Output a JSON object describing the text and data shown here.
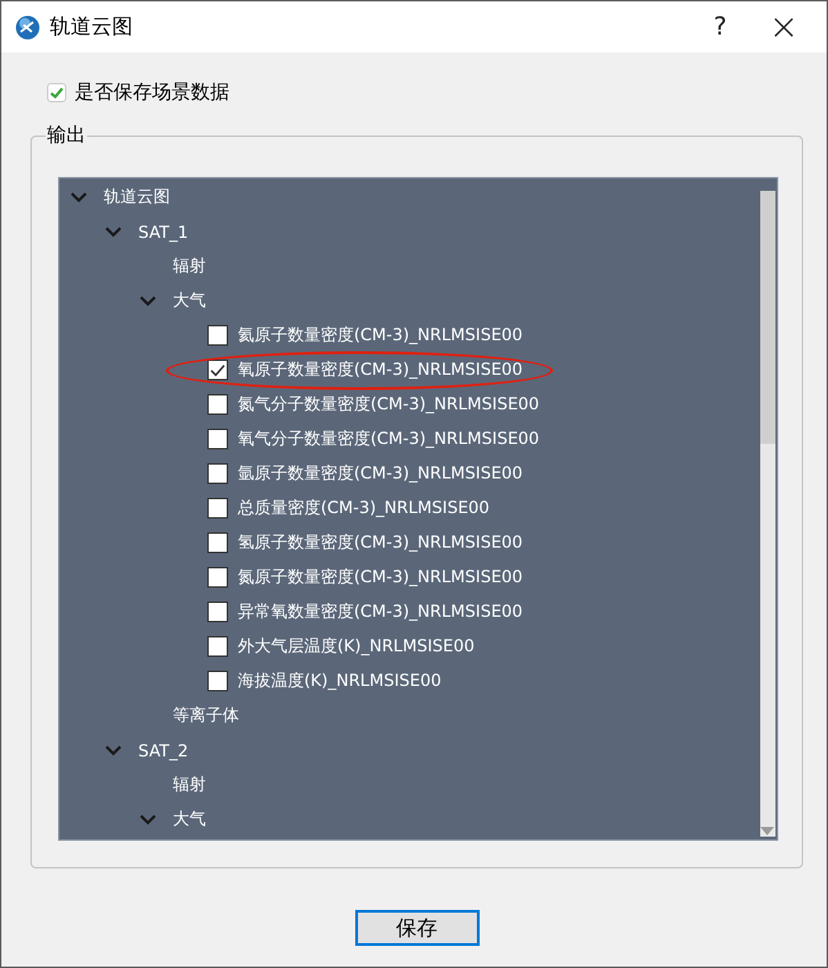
{
  "window": {
    "title": "轨道云图",
    "help": "?",
    "close": "×"
  },
  "save_scene": {
    "label": "是否保存场景数据",
    "checked": true
  },
  "output": {
    "title": "输出",
    "tree": [
      {
        "label": "轨道云图",
        "kind": "group",
        "expanded": true,
        "children": [
          {
            "label": "SAT_1",
            "kind": "group",
            "expanded": true,
            "children": [
              {
                "label": "辐射",
                "kind": "leaf"
              },
              {
                "label": "大气",
                "kind": "group",
                "expanded": true,
                "children": [
                  {
                    "label": "氦原子数量密度(CM-3)_NRLMSISE00",
                    "kind": "check",
                    "checked": false,
                    "highlighted": false
                  },
                  {
                    "label": "氧原子数量密度(CM-3)_NRLMSISE00",
                    "kind": "check",
                    "checked": true,
                    "highlighted": true
                  },
                  {
                    "label": "氮气分子数量密度(CM-3)_NRLMSISE00",
                    "kind": "check",
                    "checked": false,
                    "highlighted": false
                  },
                  {
                    "label": "氧气分子数量密度(CM-3)_NRLMSISE00",
                    "kind": "check",
                    "checked": false,
                    "highlighted": false
                  },
                  {
                    "label": "氩原子数量密度(CM-3)_NRLMSISE00",
                    "kind": "check",
                    "checked": false,
                    "highlighted": false
                  },
                  {
                    "label": "总质量密度(CM-3)_NRLMSISE00",
                    "kind": "check",
                    "checked": false,
                    "highlighted": false
                  },
                  {
                    "label": "氢原子数量密度(CM-3)_NRLMSISE00",
                    "kind": "check",
                    "checked": false,
                    "highlighted": false
                  },
                  {
                    "label": "氮原子数量密度(CM-3)_NRLMSISE00",
                    "kind": "check",
                    "checked": false,
                    "highlighted": false
                  },
                  {
                    "label": "异常氧数量密度(CM-3)_NRLMSISE00",
                    "kind": "check",
                    "checked": false,
                    "highlighted": false
                  },
                  {
                    "label": "外大气层温度(K)_NRLMSISE00",
                    "kind": "check",
                    "checked": false,
                    "highlighted": false
                  },
                  {
                    "label": "海拔温度(K)_NRLMSISE00",
                    "kind": "check",
                    "checked": false,
                    "highlighted": false
                  }
                ]
              },
              {
                "label": "等离子体",
                "kind": "leaf"
              }
            ]
          },
          {
            "label": "SAT_2",
            "kind": "group",
            "expanded": true,
            "children": [
              {
                "label": "辐射",
                "kind": "leaf"
              },
              {
                "label": "大气",
                "kind": "group",
                "expanded": true
              }
            ]
          }
        ]
      }
    ]
  },
  "buttons": [
    {
      "label": "保存",
      "focused": true
    }
  ]
}
